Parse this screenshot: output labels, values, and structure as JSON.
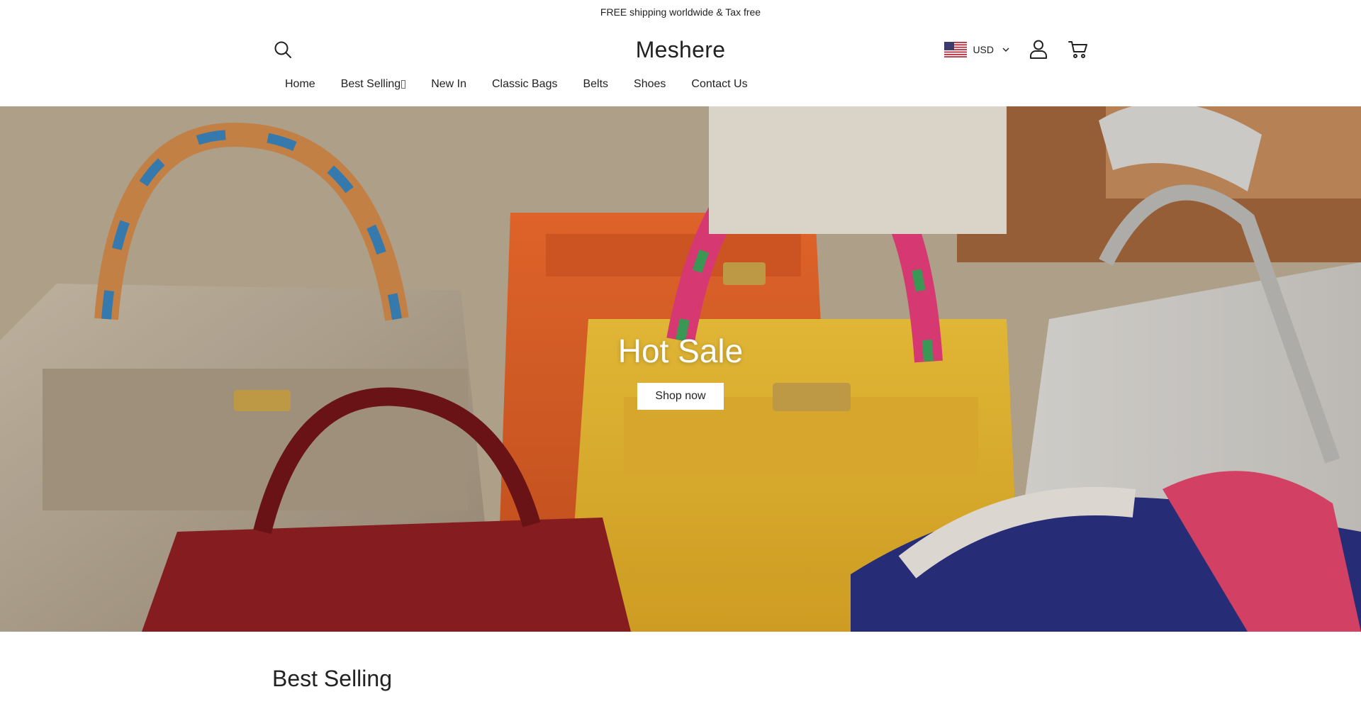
{
  "announcement": "FREE shipping worldwide & Tax free",
  "header": {
    "logo": "Meshere",
    "currency": "USD",
    "icons": {
      "search": "search-icon",
      "account": "user-icon",
      "cart": "cart-icon",
      "flag": "us-flag-icon",
      "chevron": "chevron-down-icon"
    }
  },
  "nav": {
    "items": [
      {
        "label": "Home"
      },
      {
        "label": "Best Selling"
      },
      {
        "label": "New In"
      },
      {
        "label": "Classic Bags"
      },
      {
        "label": "Belts"
      },
      {
        "label": "Shoes"
      },
      {
        "label": "Contact Us"
      }
    ]
  },
  "hero": {
    "title": "Hot Sale",
    "button": "Shop now"
  },
  "section": {
    "title": "Best Selling"
  },
  "colors": {
    "text": "#222222",
    "background": "#ffffff",
    "hero_orange": "#e0602a",
    "hero_yellow": "#e8b32a",
    "hero_red": "#8e1e22"
  }
}
